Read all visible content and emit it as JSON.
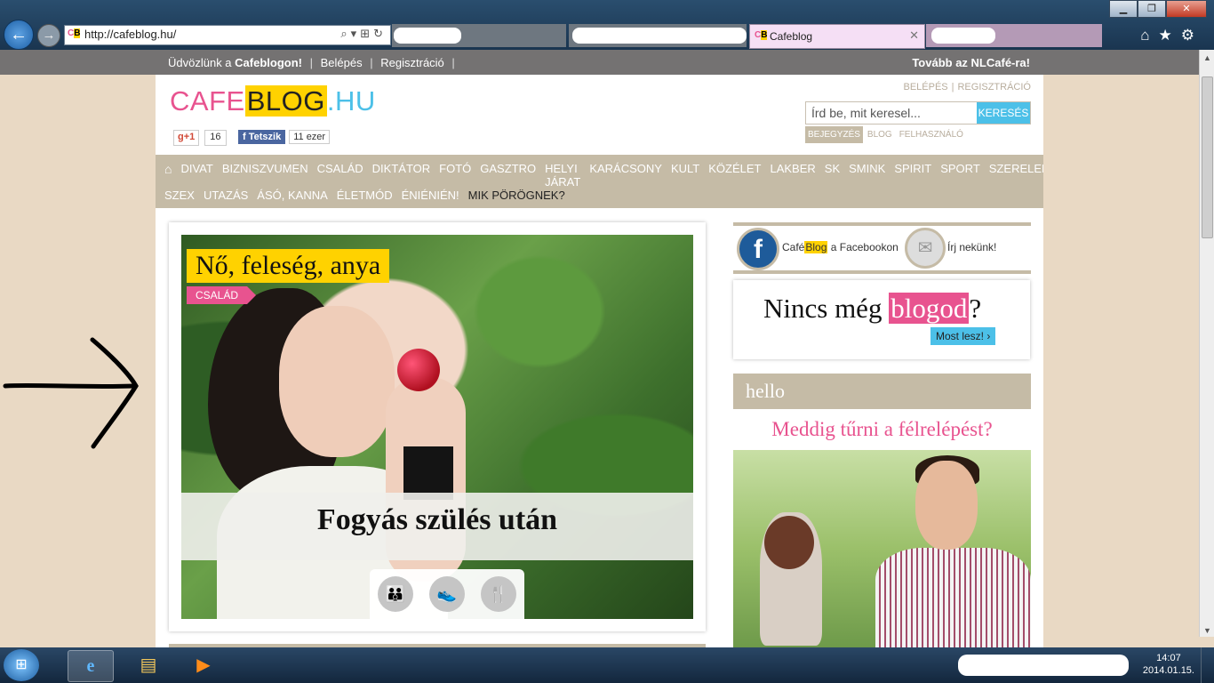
{
  "browser": {
    "address": "http://cafeblog.hu/",
    "favicon": "CB",
    "active_tab": "Cafeblog",
    "window_controls": [
      "minimize",
      "maximize",
      "close"
    ],
    "nav_icons": [
      "home-icon",
      "star-icon",
      "gear-icon"
    ]
  },
  "topstrip": {
    "welcome_prefix": "Üdvözlünk a",
    "welcome_brand": "Cafeblogon!",
    "login": "Belépés",
    "register": "Regisztráció",
    "nlcafe": "Tovább az NLCafé-ra!"
  },
  "header": {
    "logo": {
      "cafe": "CAFE",
      "blog": "BLOG",
      "hu": ".HU"
    },
    "gplus_label": "+1",
    "gplus_count": "16",
    "fb_label": "Tetszik",
    "fb_count": "11 ezer",
    "login_link": "BELÉPÉS",
    "register_link": "REGISZTRÁCIÓ",
    "search_placeholder": "Írd be, mit keresel...",
    "search_button": "KERESÉS",
    "search_tabs": [
      "BEJEGYZÉS",
      "BLOG",
      "FELHASZNÁLÓ"
    ]
  },
  "nav": {
    "row1": [
      "DIVAT",
      "BIZNISZVUMEN",
      "CSALÁD",
      "DIKTÁTOR",
      "FOTÓ",
      "GASZTRO",
      "HELYI JÁRAT",
      "KARÁCSONY",
      "KULT",
      "KÖZÉLET",
      "LAKBER",
      "SK",
      "SMINK",
      "SPIRIT",
      "SPORT",
      "SZERELEM"
    ],
    "row2": [
      "SZEX",
      "UTAZÁS",
      "ÁSÓ, KANNA",
      "ÉLETMÓD",
      "ÉNIÉNIÉN!"
    ],
    "highlight": "MIK PÖRÖGNEK?"
  },
  "featured": {
    "kicker": "Nő, feleség, anya",
    "category": "CSALÁD",
    "title": "Fogyás szülés után",
    "icons": [
      "family-icon",
      "shoes-icon",
      "cutlery-icon"
    ]
  },
  "sidebar": {
    "facebook_prefix": "Café",
    "facebook_blog": "Blog",
    "facebook_suffix": "a Facebookon",
    "mail_label": "Írj nekünk!",
    "noblog_prefix": "Nincs még",
    "noblog_highlight": "blogod",
    "noblog_suffix": "?",
    "noblog_button": "Most lesz!",
    "hello_heading": "hello",
    "hello_title": "Meddig tűrni a félrelépést?"
  },
  "taskbar": {
    "time": "14:07",
    "date": "2014.01.15."
  }
}
